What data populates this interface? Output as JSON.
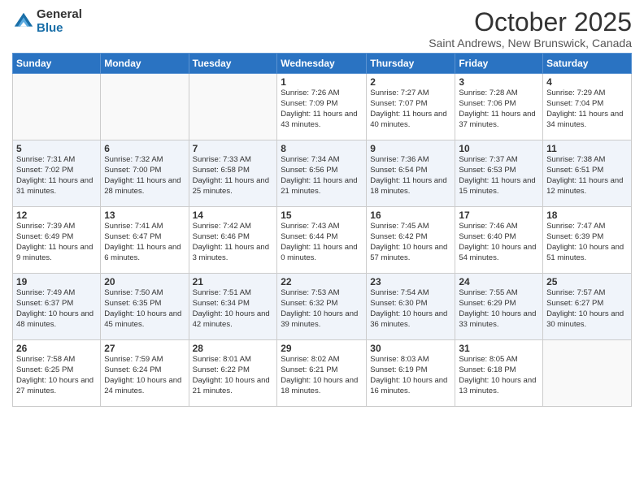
{
  "logo": {
    "general": "General",
    "blue": "Blue"
  },
  "title": "October 2025",
  "subtitle": "Saint Andrews, New Brunswick, Canada",
  "weekdays": [
    "Sunday",
    "Monday",
    "Tuesday",
    "Wednesday",
    "Thursday",
    "Friday",
    "Saturday"
  ],
  "weeks": [
    [
      {
        "day": "",
        "info": ""
      },
      {
        "day": "",
        "info": ""
      },
      {
        "day": "",
        "info": ""
      },
      {
        "day": "1",
        "info": "Sunrise: 7:26 AM\nSunset: 7:09 PM\nDaylight: 11 hours and 43 minutes."
      },
      {
        "day": "2",
        "info": "Sunrise: 7:27 AM\nSunset: 7:07 PM\nDaylight: 11 hours and 40 minutes."
      },
      {
        "day": "3",
        "info": "Sunrise: 7:28 AM\nSunset: 7:06 PM\nDaylight: 11 hours and 37 minutes."
      },
      {
        "day": "4",
        "info": "Sunrise: 7:29 AM\nSunset: 7:04 PM\nDaylight: 11 hours and 34 minutes."
      }
    ],
    [
      {
        "day": "5",
        "info": "Sunrise: 7:31 AM\nSunset: 7:02 PM\nDaylight: 11 hours and 31 minutes."
      },
      {
        "day": "6",
        "info": "Sunrise: 7:32 AM\nSunset: 7:00 PM\nDaylight: 11 hours and 28 minutes."
      },
      {
        "day": "7",
        "info": "Sunrise: 7:33 AM\nSunset: 6:58 PM\nDaylight: 11 hours and 25 minutes."
      },
      {
        "day": "8",
        "info": "Sunrise: 7:34 AM\nSunset: 6:56 PM\nDaylight: 11 hours and 21 minutes."
      },
      {
        "day": "9",
        "info": "Sunrise: 7:36 AM\nSunset: 6:54 PM\nDaylight: 11 hours and 18 minutes."
      },
      {
        "day": "10",
        "info": "Sunrise: 7:37 AM\nSunset: 6:53 PM\nDaylight: 11 hours and 15 minutes."
      },
      {
        "day": "11",
        "info": "Sunrise: 7:38 AM\nSunset: 6:51 PM\nDaylight: 11 hours and 12 minutes."
      }
    ],
    [
      {
        "day": "12",
        "info": "Sunrise: 7:39 AM\nSunset: 6:49 PM\nDaylight: 11 hours and 9 minutes."
      },
      {
        "day": "13",
        "info": "Sunrise: 7:41 AM\nSunset: 6:47 PM\nDaylight: 11 hours and 6 minutes."
      },
      {
        "day": "14",
        "info": "Sunrise: 7:42 AM\nSunset: 6:46 PM\nDaylight: 11 hours and 3 minutes."
      },
      {
        "day": "15",
        "info": "Sunrise: 7:43 AM\nSunset: 6:44 PM\nDaylight: 11 hours and 0 minutes."
      },
      {
        "day": "16",
        "info": "Sunrise: 7:45 AM\nSunset: 6:42 PM\nDaylight: 10 hours and 57 minutes."
      },
      {
        "day": "17",
        "info": "Sunrise: 7:46 AM\nSunset: 6:40 PM\nDaylight: 10 hours and 54 minutes."
      },
      {
        "day": "18",
        "info": "Sunrise: 7:47 AM\nSunset: 6:39 PM\nDaylight: 10 hours and 51 minutes."
      }
    ],
    [
      {
        "day": "19",
        "info": "Sunrise: 7:49 AM\nSunset: 6:37 PM\nDaylight: 10 hours and 48 minutes."
      },
      {
        "day": "20",
        "info": "Sunrise: 7:50 AM\nSunset: 6:35 PM\nDaylight: 10 hours and 45 minutes."
      },
      {
        "day": "21",
        "info": "Sunrise: 7:51 AM\nSunset: 6:34 PM\nDaylight: 10 hours and 42 minutes."
      },
      {
        "day": "22",
        "info": "Sunrise: 7:53 AM\nSunset: 6:32 PM\nDaylight: 10 hours and 39 minutes."
      },
      {
        "day": "23",
        "info": "Sunrise: 7:54 AM\nSunset: 6:30 PM\nDaylight: 10 hours and 36 minutes."
      },
      {
        "day": "24",
        "info": "Sunrise: 7:55 AM\nSunset: 6:29 PM\nDaylight: 10 hours and 33 minutes."
      },
      {
        "day": "25",
        "info": "Sunrise: 7:57 AM\nSunset: 6:27 PM\nDaylight: 10 hours and 30 minutes."
      }
    ],
    [
      {
        "day": "26",
        "info": "Sunrise: 7:58 AM\nSunset: 6:25 PM\nDaylight: 10 hours and 27 minutes."
      },
      {
        "day": "27",
        "info": "Sunrise: 7:59 AM\nSunset: 6:24 PM\nDaylight: 10 hours and 24 minutes."
      },
      {
        "day": "28",
        "info": "Sunrise: 8:01 AM\nSunset: 6:22 PM\nDaylight: 10 hours and 21 minutes."
      },
      {
        "day": "29",
        "info": "Sunrise: 8:02 AM\nSunset: 6:21 PM\nDaylight: 10 hours and 18 minutes."
      },
      {
        "day": "30",
        "info": "Sunrise: 8:03 AM\nSunset: 6:19 PM\nDaylight: 10 hours and 16 minutes."
      },
      {
        "day": "31",
        "info": "Sunrise: 8:05 AM\nSunset: 6:18 PM\nDaylight: 10 hours and 13 minutes."
      },
      {
        "day": "",
        "info": ""
      }
    ]
  ]
}
